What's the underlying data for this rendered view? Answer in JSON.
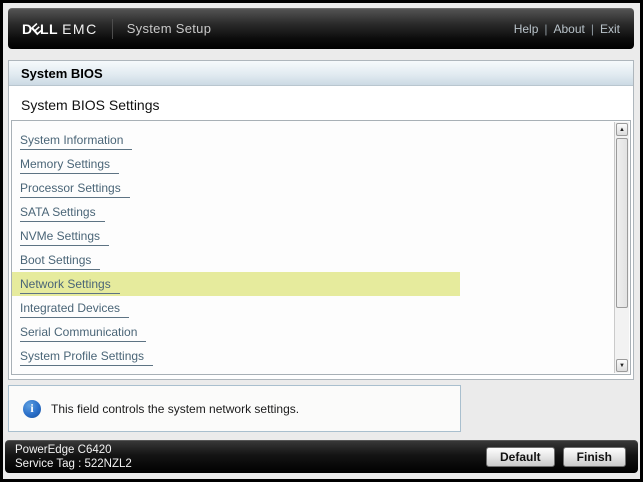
{
  "topbar": {
    "brand": {
      "d": "D",
      "e": "E",
      "ll": "LL",
      "emc": "EMC"
    },
    "app_title": "System Setup",
    "links": [
      "Help",
      "About",
      "Exit"
    ],
    "link_separator": "|"
  },
  "page": {
    "section_title": "System BIOS",
    "page_title": "System BIOS Settings",
    "menu_items": [
      {
        "label": "System Information",
        "highlighted": false
      },
      {
        "label": "Memory Settings",
        "highlighted": false
      },
      {
        "label": "Processor Settings",
        "highlighted": false
      },
      {
        "label": "SATA Settings",
        "highlighted": false
      },
      {
        "label": "NVMe Settings",
        "highlighted": false
      },
      {
        "label": "Boot Settings",
        "highlighted": false
      },
      {
        "label": "Network Settings",
        "highlighted": true
      },
      {
        "label": "Integrated Devices",
        "highlighted": false
      },
      {
        "label": "Serial Communication",
        "highlighted": false
      },
      {
        "label": "System Profile Settings",
        "highlighted": false
      }
    ],
    "highlight_color": "#e6eb9d",
    "link_color": "#4a6577"
  },
  "scrollbar": {
    "up_glyph": "▲",
    "down_glyph": "▼"
  },
  "info_panel": {
    "icon_glyph": "i",
    "text": "This field controls the system network settings."
  },
  "footer": {
    "model": "PowerEdge C6420",
    "service_tag": "Service Tag : 522NZL2",
    "buttons": [
      {
        "label": "Default"
      },
      {
        "label": "Finish"
      }
    ]
  }
}
